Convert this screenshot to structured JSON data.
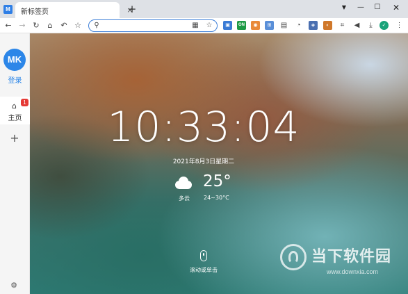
{
  "browser": {
    "tab_title": "新标签页",
    "new_tab_icon": "+",
    "tab_close_icon": "×"
  },
  "toolbar": {
    "address_placeholder": "",
    "extensions": [
      {
        "name": "wallet-ext",
        "glyph": "▣"
      },
      {
        "name": "on-ext",
        "glyph": "ON"
      },
      {
        "name": "bottle-ext",
        "glyph": "◉"
      },
      {
        "name": "grid-ext",
        "glyph": "⊞"
      },
      {
        "name": "table-ext",
        "glyph": "▤"
      },
      {
        "name": "speed-ext",
        "glyph": "◔"
      },
      {
        "name": "puzzle-ext",
        "glyph": "◈"
      },
      {
        "name": "shield-ext",
        "glyph": "◐"
      },
      {
        "name": "crop-ext",
        "glyph": "⌗"
      },
      {
        "name": "mute-ext",
        "glyph": "◀"
      },
      {
        "name": "download-ext",
        "glyph": "⤓"
      },
      {
        "name": "profile-ext",
        "glyph": "✓"
      },
      {
        "name": "menu-ext",
        "glyph": "⋮"
      }
    ]
  },
  "sidebar": {
    "avatar_text": "MK",
    "login_label": "登录",
    "home_label": "主页",
    "home_badge": "1",
    "settings_label": "设置"
  },
  "main": {
    "time": "10:33:04",
    "date": "2021年8月3日星期二",
    "weather_desc": "多云",
    "temperature": "25°",
    "temp_range": "24~30°C",
    "scroll_hint": "滚动或单击"
  },
  "watermark": {
    "name": "当下软件园",
    "url": "www.downxia.com"
  },
  "colors": {
    "accent": "#2c86e8",
    "badge": "#e53935",
    "address_border": "#3d7fd8"
  }
}
